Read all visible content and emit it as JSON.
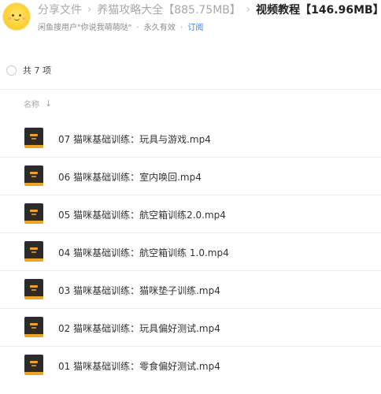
{
  "breadcrumb": {
    "root": "分享文件",
    "parent": "养猫攻略大全【885.75MB】",
    "current": "视频教程【146.96MB】",
    "separator": "›"
  },
  "share_meta": {
    "owner": "闲鱼搜用户\"你说我萌萌哒\"",
    "dot": "·",
    "validity": "永久有效",
    "subscribe": "订阅"
  },
  "list": {
    "count_label": "共 7 项",
    "column_name": "名称",
    "sort_arrow": "↓"
  },
  "files": [
    {
      "name": "07 猫咪基础训练：玩具与游戏.mp4"
    },
    {
      "name": "06 猫咪基础训练：室内唤回.mp4"
    },
    {
      "name": "05 猫咪基础训练：航空箱训练2.0.mp4"
    },
    {
      "name": "04 猫咪基础训练：航空箱训练 1.0.mp4"
    },
    {
      "name": "03 猫咪基础训练：猫咪垫子训练.mp4"
    },
    {
      "name": "02 猫咪基础训练：玩具偏好测试.mp4"
    },
    {
      "name": "01 猫咪基础训练：零食偏好测试.mp4"
    }
  ],
  "colors": {
    "link": "#3a7af5",
    "video_icon_bg": "#2b2b2b",
    "video_icon_accent": "#f0a320"
  },
  "icons": {
    "avatar": "sun-emoji-avatar",
    "file": "video-file-icon",
    "select": "circle-checkbox-icon"
  }
}
